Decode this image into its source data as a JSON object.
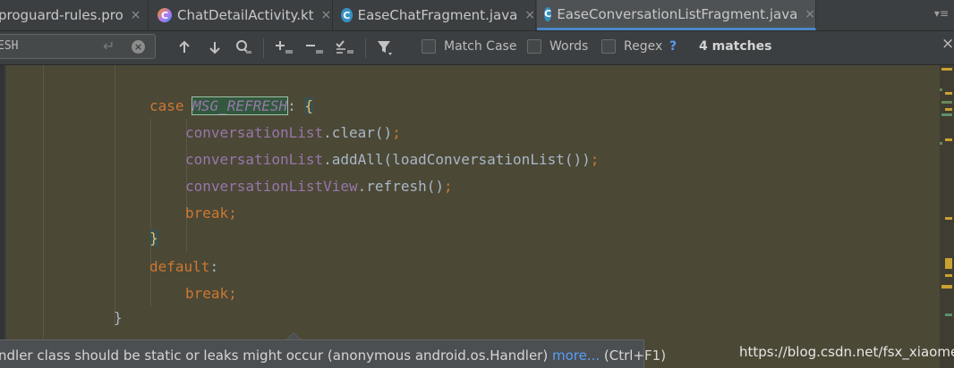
{
  "tabs": [
    {
      "label": "proguard-rules.pro",
      "icon": "pro-file-icon",
      "active": false
    },
    {
      "label": "ChatDetailActivity.kt",
      "icon": "kotlin-file-icon",
      "active": false
    },
    {
      "label": "EaseChatFragment.java",
      "icon": "java-class-icon",
      "active": false
    },
    {
      "label": "EaseConversationListFragment.java",
      "icon": "java-class-icon",
      "active": true
    }
  ],
  "tab_icon_letter": "C",
  "tab_close": "×",
  "tab_overflow": "▾≡",
  "search": {
    "query": "ESH",
    "enter_glyph": "↵",
    "clear_glyph": "×",
    "match_case_label": "Match Case",
    "words_label": "Words",
    "regex_label": "Regex",
    "help": "?",
    "matches": "4 matches",
    "close": "×"
  },
  "code": {
    "l1_case": "case",
    "l1_const": "MSG_REFRESH",
    "l1_colon": ":",
    "l1_brace": "{",
    "l2_field": "conversationList",
    "l2_rest": ".clear()",
    "l2_semi": ";",
    "l3_field": "conversationList",
    "l3_rest": ".addAll(loadConversationList())",
    "l3_semi": ";",
    "l4_field": "conversationListView",
    "l4_rest": ".refresh()",
    "l4_semi": ";",
    "l5_break": "break",
    "l5_semi": ";",
    "l6_brace": "}",
    "l7_default": "default",
    "l7_colon": ":",
    "l8_break": "break",
    "l8_semi": ";",
    "l9_brace": "}"
  },
  "tooltip": {
    "text": "ndler class should be static or leaks might occur (anonymous android.os.Handler) ",
    "more": "more...",
    "shortcut": " (Ctrl+F1)"
  },
  "watermark": "https://blog.csdn.net/fsx_xiaomei",
  "colors": {
    "editor_bg": "#4b4836",
    "keyword": "#cc7832",
    "field": "#9876aa",
    "match_highlight": "#32593d",
    "link": "#589df6"
  }
}
